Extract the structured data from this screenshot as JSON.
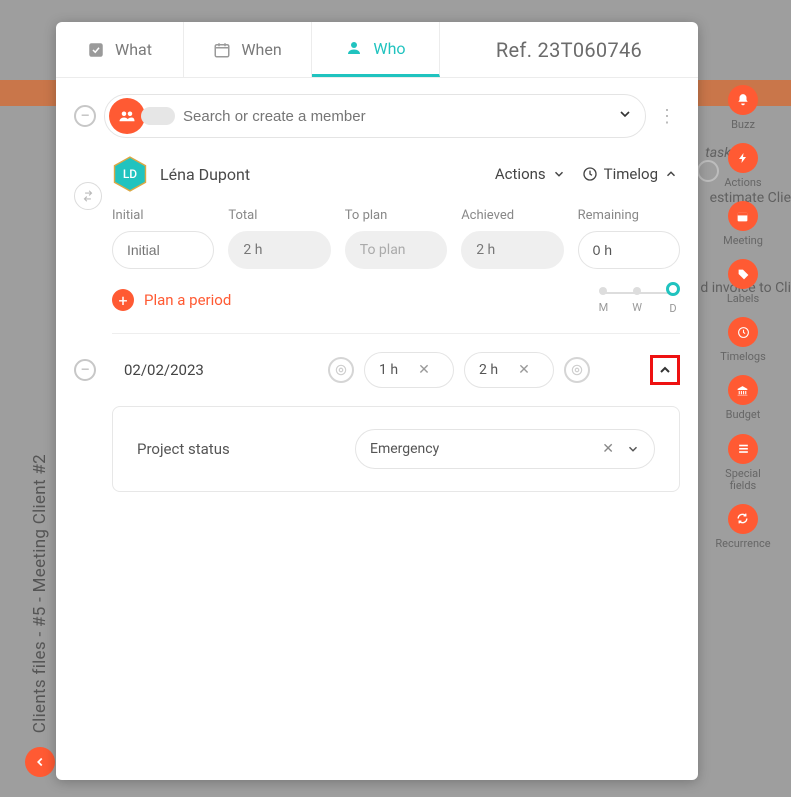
{
  "ref": "Ref. 23T060746",
  "tabs": {
    "what": "What",
    "when": "When",
    "who": "Who"
  },
  "search": {
    "placeholder": "Search or create a member"
  },
  "member": {
    "initials": "LD",
    "name": "Léna Dupont",
    "actions_label": "Actions",
    "timelog_label": "Timelog"
  },
  "time_labels": {
    "initial": "Initial",
    "total": "Total",
    "toplan": "To plan",
    "achieved": "Achieved",
    "remaining": "Remaining"
  },
  "time_values": {
    "initial_placeholder": "Initial",
    "total": "2 h",
    "toplan_placeholder": "To plan",
    "achieved": "2 h",
    "remaining": "0 h"
  },
  "plan_period": "Plan a period",
  "mwd": {
    "m": "M",
    "w": "W",
    "d": "D"
  },
  "entry": {
    "date": "02/02/2023",
    "hours1": "1 h",
    "hours2": "2 h"
  },
  "status": {
    "label": "Project status",
    "value": "Emergency"
  },
  "left_rail": "Clients files - #5 - Meeting Client #2",
  "right_rail": {
    "buzz": "Buzz",
    "actions": "Actions",
    "meeting": "Meeting",
    "labels": "Labels",
    "timelogs": "Timelogs",
    "budget": "Budget",
    "special": "Special fields",
    "recurrence": "Recurrence"
  },
  "bg": {
    "task": "task",
    "estimate": "estimate Clie",
    "invoice": "d invoice to Cli"
  }
}
